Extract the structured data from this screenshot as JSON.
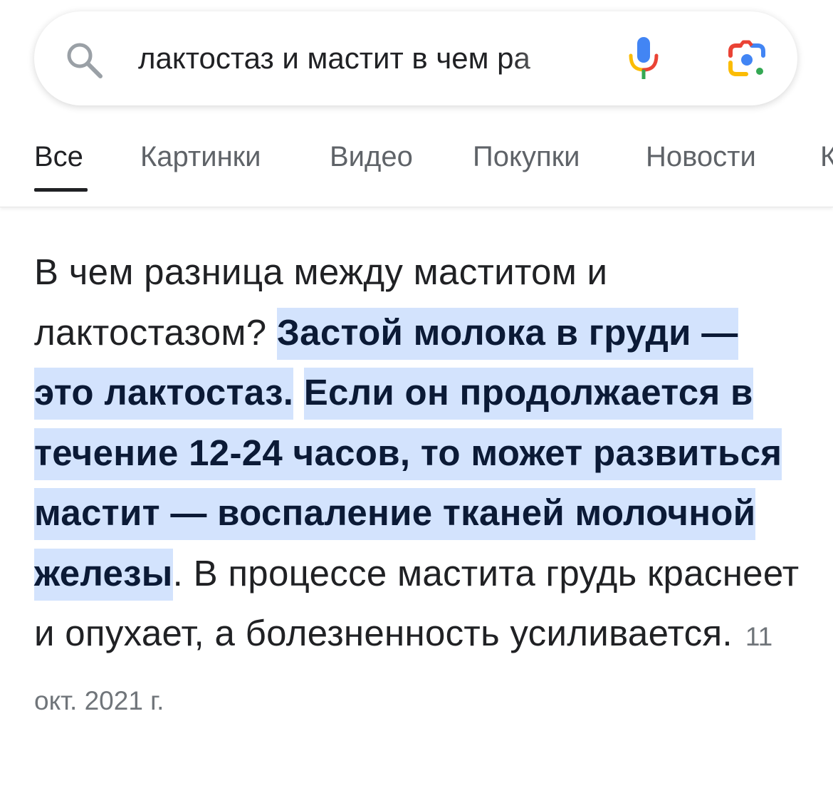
{
  "search": {
    "query": "лактостаз и мастит в чем ра"
  },
  "icons": {
    "search": "search-icon",
    "mic": "microphone-icon",
    "lens": "google-lens-icon"
  },
  "tabs": [
    {
      "label": "Все",
      "active": true
    },
    {
      "label": "Картинки",
      "active": false
    },
    {
      "label": "Видео",
      "active": false
    },
    {
      "label": "Покупки",
      "active": false
    },
    {
      "label": "Новости",
      "active": false
    },
    {
      "label": "К",
      "active": false
    }
  ],
  "answer": {
    "question": "В чем разница между маститом и лактостазом? ",
    "highlight_1": "Застой молока в груди — это лактостаз.",
    "space": " ",
    "highlight_2": "Если он продолжается в течение 12-24 часов, то может развиться мастит — воспаление тканей молочной железы",
    "rest": ". В процессе мастита грудь краснеет и опухает, а болезненность усиливается.",
    "date": "11 окт. 2021 г."
  },
  "colors": {
    "highlight_bg": "#d3e3fd",
    "highlight_text": "#0b1a36",
    "muted": "#5f6368",
    "google_blue": "#4285f4",
    "google_red": "#ea4335",
    "google_yellow": "#fbbc04",
    "google_green": "#34a853"
  }
}
